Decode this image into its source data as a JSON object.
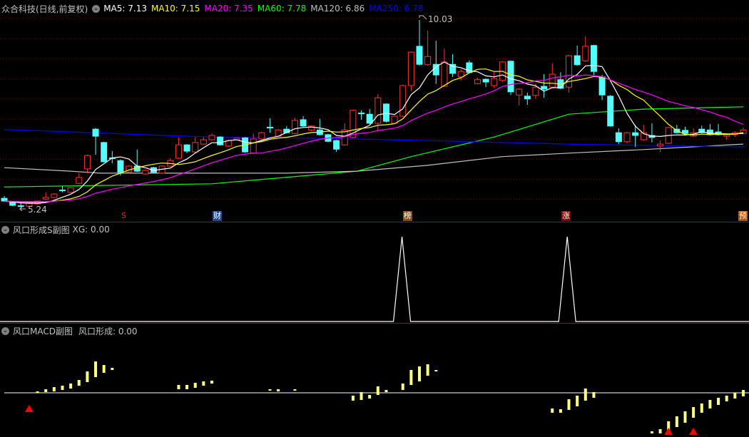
{
  "header": {
    "title": "众合科技(日线,前复权)",
    "ma": [
      {
        "label": "MA5: 7.13",
        "color": "#ffffff"
      },
      {
        "label": "MA10: 7.15",
        "color": "#ffff00"
      },
      {
        "label": "MA20: 7.35",
        "color": "#ff00ff"
      },
      {
        "label": "MA60: 7.78",
        "color": "#00ff00"
      },
      {
        "label": "MA120: 6.86",
        "color": "#c0c0c0"
      },
      {
        "label": "MA250: 6.78",
        "color": "#0000ff"
      }
    ]
  },
  "main": {
    "high_label": "10.03",
    "low_label": "5.24",
    "colors": {
      "up": "#ff3232",
      "down": "#54fcfc",
      "grid": "#800000",
      "separator": "#b00000"
    },
    "candles": [
      [
        5.49,
        5.55,
        5.4,
        5.42
      ],
      [
        5.4,
        5.42,
        5.29,
        5.31
      ],
      [
        5.3,
        5.4,
        5.24,
        5.29
      ],
      [
        5.29,
        5.38,
        5.27,
        5.37
      ],
      [
        5.35,
        5.43,
        5.33,
        5.42
      ],
      [
        5.47,
        5.64,
        5.45,
        5.51
      ],
      [
        5.51,
        5.62,
        5.49,
        5.6
      ],
      [
        5.7,
        5.8,
        5.64,
        5.68
      ],
      [
        5.64,
        5.78,
        5.62,
        5.76
      ],
      [
        5.87,
        6.13,
        5.85,
        6.02
      ],
      [
        6.24,
        6.6,
        6.13,
        6.58
      ],
      [
        7.25,
        7.28,
        6.6,
        7.07
      ],
      [
        6.91,
        6.93,
        6.4,
        6.42
      ],
      [
        6.52,
        6.69,
        6.38,
        6.5
      ],
      [
        6.45,
        6.48,
        6.07,
        6.15
      ],
      [
        6.16,
        6.33,
        6.14,
        6.31
      ],
      [
        6.31,
        6.73,
        6.16,
        6.18
      ],
      [
        6.11,
        6.22,
        6.09,
        6.2
      ],
      [
        6.27,
        6.29,
        6.13,
        6.15
      ],
      [
        6.13,
        6.33,
        6.11,
        6.31
      ],
      [
        6.31,
        6.51,
        6.29,
        6.45
      ],
      [
        6.51,
        7.04,
        6.49,
        6.85
      ],
      [
        6.85,
        6.87,
        6.64,
        6.69
      ],
      [
        6.67,
        7.05,
        6.65,
        6.91
      ],
      [
        6.87,
        7.05,
        6.85,
        6.98
      ],
      [
        6.98,
        7.14,
        6.96,
        7.09
      ],
      [
        7.05,
        7.07,
        6.83,
        6.85
      ],
      [
        6.82,
        6.98,
        6.8,
        6.96
      ],
      [
        6.98,
        7.03,
        6.96,
        7.02
      ],
      [
        7.03,
        7.05,
        6.65,
        6.67
      ],
      [
        6.64,
        7.14,
        6.62,
        7.0
      ],
      [
        7.0,
        7.18,
        6.98,
        7.16
      ],
      [
        7.3,
        7.53,
        7.16,
        7.28
      ],
      [
        7.07,
        7.25,
        7.05,
        7.23
      ],
      [
        7.25,
        7.33,
        7.14,
        7.16
      ],
      [
        7.14,
        7.54,
        7.12,
        7.47
      ],
      [
        7.49,
        7.58,
        7.31,
        7.33
      ],
      [
        7.23,
        7.35,
        7.2,
        7.33
      ],
      [
        7.23,
        7.51,
        7.09,
        7.11
      ],
      [
        7.11,
        7.13,
        6.92,
        6.94
      ],
      [
        6.96,
        6.98,
        6.67,
        6.74
      ],
      [
        6.85,
        7.4,
        6.83,
        7.23
      ],
      [
        7.04,
        7.75,
        7.02,
        7.73
      ],
      [
        7.66,
        7.73,
        7.49,
        7.64
      ],
      [
        7.63,
        7.76,
        7.38,
        7.4
      ],
      [
        7.4,
        8.14,
        7.18,
        8.05
      ],
      [
        7.89,
        7.91,
        7.42,
        7.45
      ],
      [
        7.4,
        7.6,
        7.38,
        7.58
      ],
      [
        7.58,
        8.38,
        7.56,
        8.36
      ],
      [
        8.36,
        9.23,
        8.22,
        9.21
      ],
      [
        9.36,
        10.03,
        8.87,
        8.9
      ],
      [
        8.89,
        9.76,
        8.87,
        9.1
      ],
      [
        8.9,
        9.5,
        8.4,
        8.63
      ],
      [
        8.34,
        9.3,
        8.32,
        8.96
      ],
      [
        8.9,
        9.16,
        8.58,
        8.67
      ],
      [
        8.58,
        8.78,
        8.49,
        8.72
      ],
      [
        8.94,
        9.0,
        8.67,
        8.69
      ],
      [
        8.41,
        8.56,
        8.39,
        8.51
      ],
      [
        8.52,
        8.54,
        8.32,
        8.45
      ],
      [
        8.36,
        8.7,
        8.29,
        8.54
      ],
      [
        8.49,
        8.98,
        8.45,
        8.96
      ],
      [
        8.98,
        9.0,
        8.12,
        8.2
      ],
      [
        8.12,
        8.29,
        7.85,
        8.27
      ],
      [
        8.09,
        8.18,
        7.87,
        8.02
      ],
      [
        8.11,
        8.41,
        8.02,
        8.32
      ],
      [
        8.34,
        8.65,
        8.05,
        8.27
      ],
      [
        8.32,
        8.92,
        8.3,
        8.65
      ],
      [
        8.51,
        8.7,
        8.27,
        8.29
      ],
      [
        8.32,
        9.14,
        8.18,
        9.12
      ],
      [
        9.12,
        9.38,
        8.87,
        8.89
      ],
      [
        8.99,
        9.61,
        8.96,
        9.36
      ],
      [
        9.38,
        9.4,
        8.63,
        8.72
      ],
      [
        8.58,
        8.63,
        7.99,
        8.12
      ],
      [
        8.09,
        8.12,
        7.31,
        7.33
      ],
      [
        7.16,
        7.27,
        6.87,
        6.93
      ],
      [
        6.93,
        7.18,
        6.89,
        7.16
      ],
      [
        7.16,
        7.36,
        6.8,
        7.09
      ],
      [
        6.98,
        7.36,
        6.96,
        7.16
      ],
      [
        7.09,
        7.4,
        6.91,
        7.04
      ],
      [
        6.82,
        6.96,
        6.67,
        6.87
      ],
      [
        6.89,
        7.31,
        6.87,
        7.29
      ],
      [
        7.25,
        7.36,
        7.14,
        7.16
      ],
      [
        7.22,
        7.31,
        7.12,
        7.14
      ],
      [
        7.07,
        7.27,
        7.05,
        7.16
      ],
      [
        7.25,
        7.34,
        7.14,
        7.16
      ],
      [
        7.23,
        7.38,
        7.09,
        7.11
      ],
      [
        7.18,
        7.38,
        7.09,
        7.11
      ],
      [
        7.07,
        7.13,
        6.98,
        7.11
      ],
      [
        7.11,
        7.2,
        7.05,
        7.16
      ],
      [
        7.14,
        7.29,
        7.12,
        7.23
      ]
    ],
    "ma_long": {
      "ma60": [
        [
          0,
          5.78
        ],
        [
          25,
          5.86
        ],
        [
          42.5,
          6.18
        ],
        [
          49,
          6.55
        ],
        [
          59,
          7.05
        ],
        [
          68,
          7.63
        ],
        [
          77,
          7.76
        ],
        [
          89,
          7.82
        ]
      ],
      "ma120": [
        [
          0,
          6.27
        ],
        [
          8,
          6.18
        ],
        [
          11.5,
          6.13
        ],
        [
          34,
          6.13
        ],
        [
          42.5,
          6.18
        ],
        [
          51,
          6.33
        ],
        [
          60,
          6.55
        ],
        [
          68,
          6.64
        ],
        [
          77,
          6.73
        ],
        [
          89,
          6.87
        ]
      ],
      "ma250": [
        [
          0,
          7.24
        ],
        [
          8,
          7.18
        ],
        [
          16.7,
          7.11
        ],
        [
          25,
          7.05
        ],
        [
          34,
          7.03
        ],
        [
          42.5,
          7.0
        ],
        [
          51,
          6.96
        ],
        [
          60,
          6.91
        ],
        [
          68,
          6.87
        ],
        [
          77,
          6.84
        ],
        [
          89,
          6.8
        ]
      ]
    },
    "markers": [
      {
        "text": "S",
        "index": 14.6,
        "bg": "transparent",
        "color": "#ff2020"
      },
      {
        "text": "财",
        "index": 25.7,
        "bg": "#1e4e8c",
        "color": "#ffffff"
      },
      {
        "text": "榜",
        "index": 48.6,
        "bg": "#8b4a10",
        "color": "#ffffff"
      },
      {
        "text": "涨",
        "index": 67.7,
        "bg": "#8b0000",
        "color": "#ffffff"
      },
      {
        "text": "预",
        "index": 89,
        "bg": "#b05a10",
        "color": "#ffffff"
      }
    ]
  },
  "sub1": {
    "title": "风口形成S副图",
    "value_label": "XG: 0.00",
    "xg_spikes": [
      47.9,
      67.8
    ]
  },
  "sub2": {
    "title": "风口MACD副图",
    "value_label": "风口形成: 0.00",
    "bar_color": "#ffff80",
    "signal_color": "#ff0000",
    "bars": [
      [
        4,
        0.2,
        0.1
      ],
      [
        5,
        0.5,
        0.1
      ],
      [
        6,
        0.8,
        0.2
      ],
      [
        7,
        1.0,
        0.4
      ],
      [
        8,
        1.3,
        0.6
      ],
      [
        9,
        1.8,
        1.0
      ],
      [
        10,
        3.0,
        1.5
      ],
      [
        11,
        4.4,
        2.2
      ],
      [
        12,
        3.9,
        2.8
      ],
      [
        13,
        3.5,
        3.2
      ],
      [
        21,
        1.1,
        0.5
      ],
      [
        22,
        1.1,
        0.5
      ],
      [
        23,
        1.4,
        0.7
      ],
      [
        24,
        1.6,
        1.0
      ],
      [
        25,
        1.7,
        1.3
      ],
      [
        32,
        0.5,
        0.3
      ],
      [
        33,
        0.5,
        0.2
      ],
      [
        35,
        0.5,
        0.3
      ],
      [
        42,
        -0.4,
        -1.1
      ],
      [
        43,
        0.1,
        -1.0
      ],
      [
        44,
        -0.3,
        -0.8
      ],
      [
        45,
        0.9,
        -0.3
      ],
      [
        46,
        0.4,
        0.1
      ],
      [
        48,
        1.3,
        0.4
      ],
      [
        49,
        3.2,
        1.1
      ],
      [
        50,
        3.7,
        1.6
      ],
      [
        51,
        4.0,
        2.4
      ],
      [
        52,
        3.2,
        3.1
      ],
      [
        66,
        -2.2,
        -2.8
      ],
      [
        67,
        -2.3,
        -2.8
      ],
      [
        68,
        -0.9,
        -2.4
      ],
      [
        69,
        -0.4,
        -1.9
      ],
      [
        70,
        0.6,
        -1.1
      ],
      [
        71,
        0.1,
        -0.7
      ],
      [
        78,
        -5.4,
        -5.7
      ],
      [
        79,
        -5.1,
        -5.7
      ],
      [
        80,
        -4.0,
        -5.3
      ],
      [
        81,
        -3.3,
        -4.8
      ],
      [
        82,
        -2.6,
        -4.2
      ],
      [
        83,
        -2.0,
        -3.5
      ],
      [
        84,
        -1.5,
        -2.8
      ],
      [
        85,
        -1.0,
        -2.2
      ],
      [
        86,
        -0.7,
        -1.7
      ],
      [
        87,
        -0.4,
        -1.2
      ],
      [
        88,
        0.0,
        -0.8
      ],
      [
        89,
        0.4,
        -0.5
      ]
    ],
    "signals": [
      [
        3,
        -2.2
      ],
      [
        80,
        -5.4
      ],
      [
        83,
        -5.4
      ]
    ]
  }
}
